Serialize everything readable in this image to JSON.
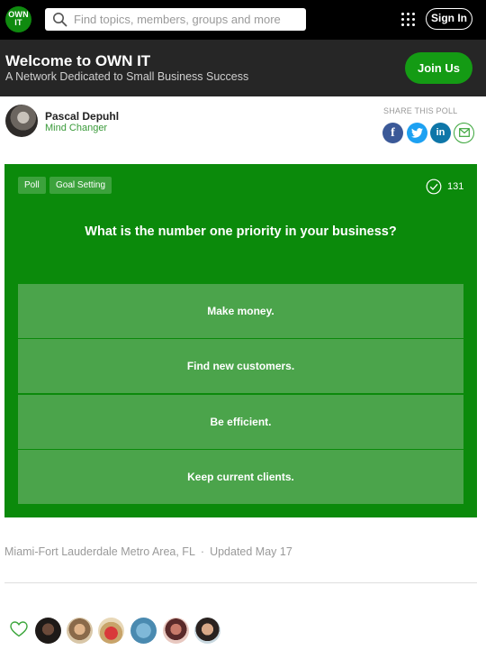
{
  "header": {
    "logo_line1": "OWN",
    "logo_line2": "IT",
    "search_placeholder": "Find topics, members, groups and more",
    "signin_label": "Sign In",
    "icons": [
      "search-icon",
      "apps-grid-icon"
    ]
  },
  "banner": {
    "title": "Welcome to OWN IT",
    "subtitle": "A Network Dedicated to Small Business Success",
    "join_label": "Join Us"
  },
  "author": {
    "name": "Pascal Depuhl",
    "role": "Mind Changer"
  },
  "share": {
    "label": "SHARE THIS POLL",
    "facebook": "f",
    "linkedin": "in"
  },
  "poll": {
    "tags": [
      "Poll",
      "Goal Setting"
    ],
    "vote_count": "131",
    "question": "What is the number one priority in your business?",
    "options": [
      "Make money.",
      "Find new customers.",
      "Be efficient.",
      "Keep current clients."
    ]
  },
  "meta": {
    "location": "Miami-Fort Lauderdale Metro Area, FL",
    "separator": "·",
    "updated": "Updated May 17"
  },
  "colors": {
    "brand_green": "#0b8a0b",
    "option_green": "#4ba44b",
    "join_green": "#149b14"
  }
}
